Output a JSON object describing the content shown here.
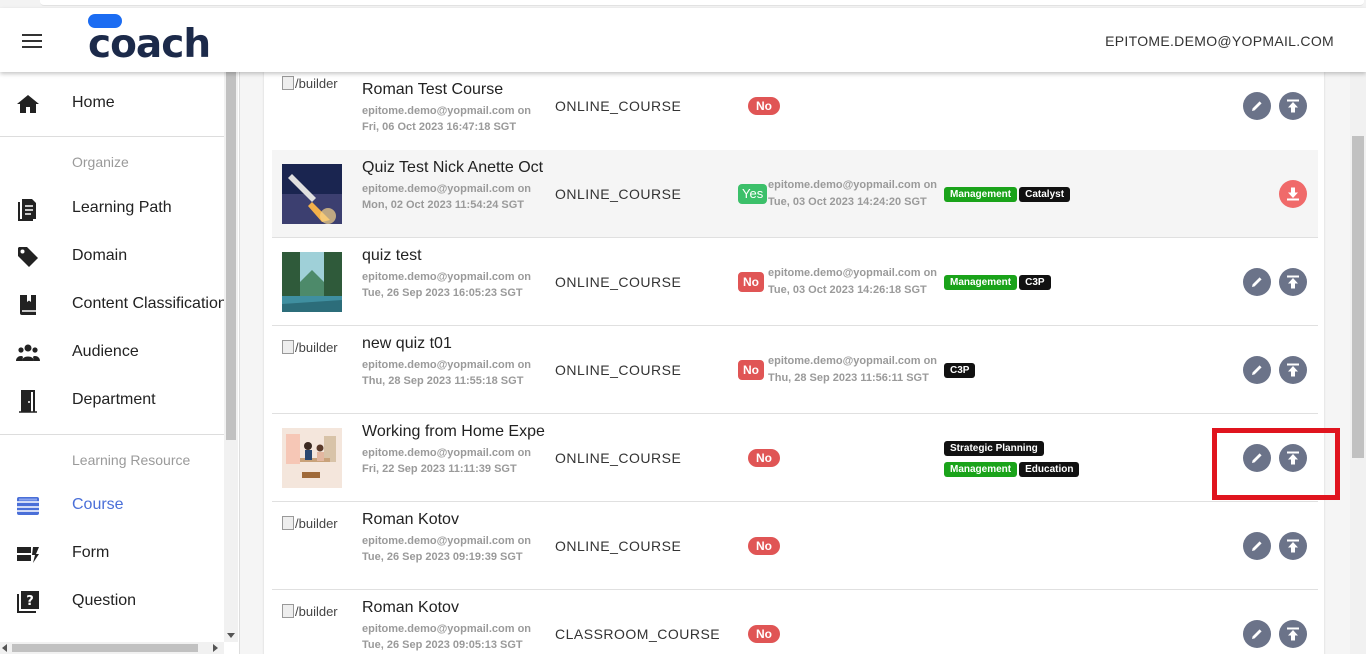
{
  "header": {
    "logo_text": "coach",
    "user_email": "EPITOME.DEMO@YOPMAIL.COM",
    "colors": {
      "logo_pill": "#1b6cf2",
      "logo_text": "#1c2a4a"
    }
  },
  "sidebar": {
    "items_top": [
      {
        "label": "Home",
        "icon": "home-icon"
      }
    ],
    "section_organize": "Organize",
    "items_organize": [
      {
        "label": "Learning Path",
        "icon": "document-icon"
      },
      {
        "label": "Domain",
        "icon": "tag-icon"
      },
      {
        "label": "Content Classification",
        "icon": "book-icon"
      },
      {
        "label": "Audience",
        "icon": "group-icon"
      },
      {
        "label": "Department",
        "icon": "door-icon"
      }
    ],
    "section_learning": "Learning Resource",
    "items_learning": [
      {
        "label": "Course",
        "icon": "course-icon",
        "active": true
      },
      {
        "label": "Form",
        "icon": "form-icon"
      },
      {
        "label": "Question",
        "icon": "question-icon"
      }
    ],
    "active_color": "#4a6fd8"
  },
  "courses": [
    {
      "title": "Roman Test Course",
      "creator": "epitome.demo@yopmail.com on",
      "created": "Fri, 06 Oct 2023 16:47:18 SGT",
      "type": "ONLINE_COURSE",
      "published": "No",
      "image": "broken",
      "image_alt": "/builder"
    },
    {
      "title": "Quiz Test Nick Anette Oct",
      "creator": "epitome.demo@yopmail.com on",
      "created": "Mon, 02 Oct 2023 11:54:24 SGT",
      "type": "ONLINE_COURSE",
      "published": "Yes",
      "approver": "epitome.demo@yopmail.com on",
      "approved": "Tue, 03 Oct 2023 14:24:20 SGT",
      "tags": [
        {
          "label": "Management",
          "color": "green"
        },
        {
          "label": "Catalyst",
          "color": "black"
        }
      ],
      "image": "rocket"
    },
    {
      "title": "quiz test",
      "creator": "epitome.demo@yopmail.com on",
      "created": "Tue, 26 Sep 2023 16:05:23 SGT",
      "type": "ONLINE_COURSE",
      "published": "No",
      "approver": "epitome.demo@yopmail.com on",
      "approved": "Tue, 03 Oct 2023 14:26:18 SGT",
      "tags": [
        {
          "label": "Management",
          "color": "green"
        },
        {
          "label": "C3P",
          "color": "black"
        }
      ],
      "image": "forest"
    },
    {
      "title": "new quiz t01",
      "creator": "epitome.demo@yopmail.com on",
      "created": "Thu, 28 Sep 2023 11:55:18 SGT",
      "type": "ONLINE_COURSE",
      "published": "No",
      "approver": "epitome.demo@yopmail.com on",
      "approved": "Thu, 28 Sep 2023 11:56:11 SGT",
      "tags": [
        {
          "label": "C3P",
          "color": "black"
        }
      ],
      "image": "broken",
      "image_alt": "/builder"
    },
    {
      "title": "Working from Home Expe",
      "creator": "epitome.demo@yopmail.com on",
      "created": "Fri, 22 Sep 2023 11:11:39 SGT",
      "type": "ONLINE_COURSE",
      "published": "No",
      "tags": [
        {
          "label": "Strategic Planning",
          "color": "black"
        },
        {
          "label": "Management",
          "color": "green"
        },
        {
          "label": "Education",
          "color": "black"
        }
      ],
      "image": "office"
    },
    {
      "title": "Roman Kotov",
      "creator": "epitome.demo@yopmail.com on",
      "created": "Tue, 26 Sep 2023 09:19:39 SGT",
      "type": "ONLINE_COURSE",
      "published": "No",
      "image": "broken",
      "image_alt": "/builder"
    },
    {
      "title": "Roman Kotov",
      "creator": "epitome.demo@yopmail.com on",
      "created": "Tue, 26 Sep 2023 09:05:13 SGT",
      "type": "CLASSROOM_COURSE",
      "published": "No",
      "image": "broken",
      "image_alt": "/builder"
    }
  ],
  "colors": {
    "no_badge": "#e05555",
    "yes_badge": "#3cc06a",
    "tag_green": "#1aa31a",
    "tag_black": "#111111",
    "action": "#6b7389",
    "unpublish": "#f06a6a",
    "highlight": "#e0141e"
  }
}
